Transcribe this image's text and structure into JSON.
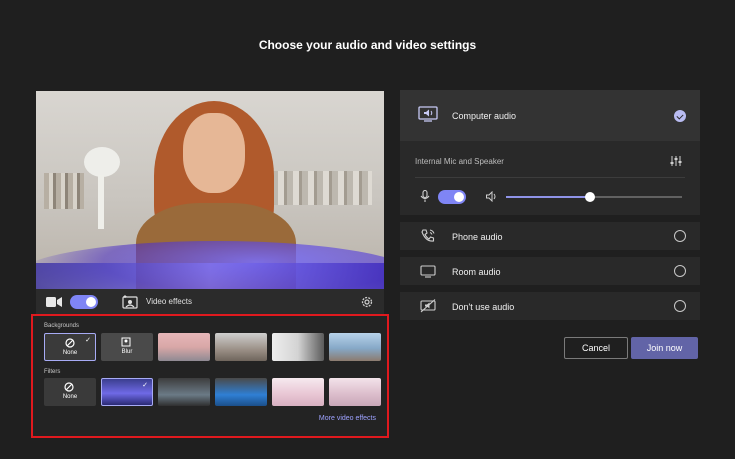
{
  "page": {
    "title": "Choose your audio and video settings"
  },
  "video": {
    "camera_on": true,
    "effects_label": "Video effects"
  },
  "effects": {
    "backgrounds_label": "Backgrounds",
    "backgrounds": [
      {
        "label": "None",
        "selected": true
      },
      {
        "label": "Blur",
        "selected": false
      },
      {
        "label": "",
        "selected": false
      },
      {
        "label": "",
        "selected": false
      },
      {
        "label": "",
        "selected": false
      },
      {
        "label": "",
        "selected": false
      }
    ],
    "filters_label": "Filters",
    "filters": [
      {
        "label": "None",
        "selected": false
      },
      {
        "label": "",
        "selected": true
      },
      {
        "label": "",
        "selected": false
      },
      {
        "label": "",
        "selected": false
      },
      {
        "label": "",
        "selected": false
      },
      {
        "label": "",
        "selected": false
      }
    ],
    "more_link": "More video effects"
  },
  "audio": {
    "computer_audio": {
      "label": "Computer audio",
      "selected": true
    },
    "device": "Internal Mic and Speaker",
    "mic_on": true,
    "volume": 0.48,
    "options": [
      {
        "label": "Phone audio",
        "icon": "phone-icon"
      },
      {
        "label": "Room audio",
        "icon": "monitor-icon"
      },
      {
        "label": "Don't use audio",
        "icon": "no-audio-icon"
      }
    ]
  },
  "buttons": {
    "cancel": "Cancel",
    "join": "Join now"
  },
  "colors": {
    "accent": "#6264a7",
    "highlight_border": "#e0191e"
  }
}
